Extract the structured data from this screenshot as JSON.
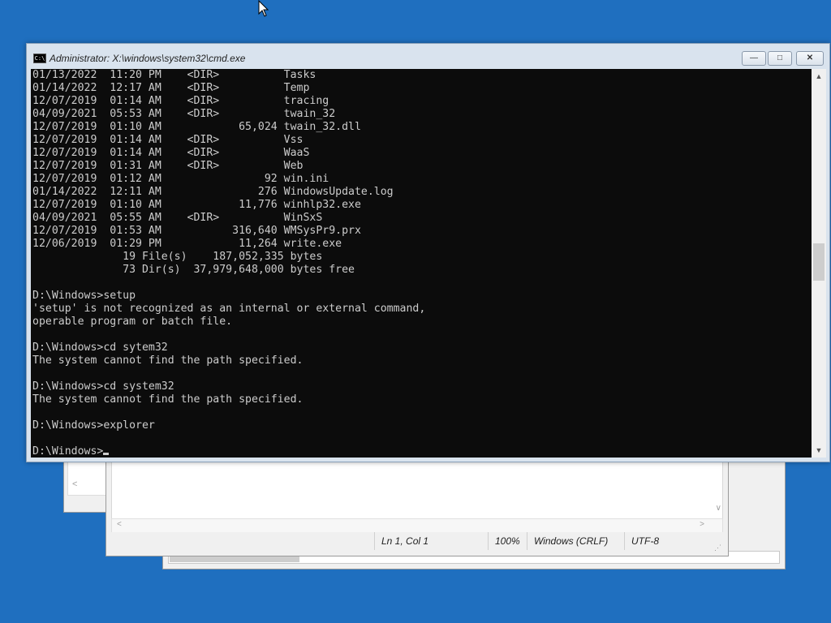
{
  "desktop": {
    "background": "#1f6fbf"
  },
  "cmd_window": {
    "title": "Administrator: X:\\windows\\system32\\cmd.exe",
    "icon_label": "C:\\",
    "buttons": {
      "minimize": "—",
      "maximize": "□",
      "close": "✕"
    },
    "console_text": "01/13/2022  11:20 PM    <DIR>          Tasks\n01/14/2022  12:17 AM    <DIR>          Temp\n12/07/2019  01:14 AM    <DIR>          tracing\n04/09/2021  05:53 AM    <DIR>          twain_32\n12/07/2019  01:10 AM            65,024 twain_32.dll\n12/07/2019  01:14 AM    <DIR>          Vss\n12/07/2019  01:14 AM    <DIR>          WaaS\n12/07/2019  01:31 AM    <DIR>          Web\n12/07/2019  01:12 AM                92 win.ini\n01/14/2022  12:11 AM               276 WindowsUpdate.log\n12/07/2019  01:10 AM            11,776 winhlp32.exe\n04/09/2021  05:55 AM    <DIR>          WinSxS\n12/07/2019  01:53 AM           316,640 WMSysPr9.prx\n12/06/2019  01:29 PM            11,264 write.exe\n              19 File(s)    187,052,335 bytes\n              73 Dir(s)  37,979,648,000 bytes free\n\nD:\\Windows>setup\n'setup' is not recognized as an internal or external command,\noperable program or batch file.\n\nD:\\Windows>cd sytem32\nThe system cannot find the path specified.\n\nD:\\Windows>cd system32\nThe system cannot find the path specified.\n\nD:\\Windows>explorer\n\n",
    "prompt": "D:\\Windows>",
    "scrollbar": {
      "up_arrow": "▲",
      "down_arrow": "▼"
    }
  },
  "notepad_window": {
    "status": {
      "position": "Ln 1, Col 1",
      "zoom": "100%",
      "line_ending": "Windows (CRLF)",
      "encoding": "UTF-8"
    },
    "scroll": {
      "left_arrow": "<",
      "right_arrow": ">",
      "down_arrow": "∨"
    }
  },
  "back_window": {
    "left_arrow": "<"
  }
}
